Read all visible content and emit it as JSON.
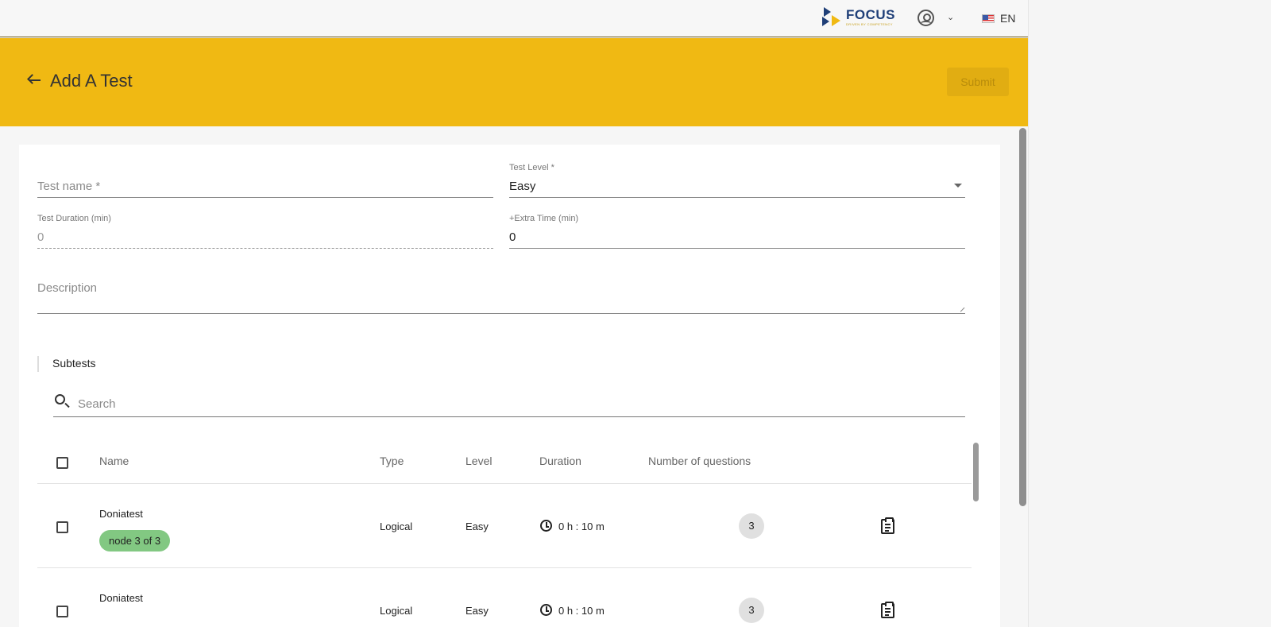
{
  "topbar": {
    "brand_name": "FOCUS",
    "brand_tagline": "DRIVEN BY COMPETENCY",
    "language": "EN"
  },
  "header": {
    "title": "Add A Test",
    "submit_label": "Submit"
  },
  "form": {
    "test_name_placeholder": "Test name *",
    "test_level_label": "Test Level *",
    "test_level_value": "Easy",
    "duration_label": "Test Duration (min)",
    "duration_value": "0",
    "extra_time_label": "+Extra Time (min)",
    "extra_time_value": "0",
    "description_placeholder": "Description"
  },
  "subtests": {
    "label": "Subtests",
    "search_placeholder": "Search",
    "columns": {
      "name": "Name",
      "type": "Type",
      "level": "Level",
      "duration": "Duration",
      "questions": "Number of questions"
    },
    "rows": [
      {
        "name": "Doniatest",
        "tag": "node 3 of 3",
        "type": "Logical",
        "level": "Easy",
        "duration": "0 h : 10 m",
        "questions": "3"
      },
      {
        "name": "Doniatest",
        "tag": "",
        "type": "Logical",
        "level": "Easy",
        "duration": "0 h : 10 m",
        "questions": "3"
      }
    ]
  },
  "colors": {
    "accent_yellow": "#f0b913",
    "brand_blue": "#1f3f78",
    "tag_green": "#82c882"
  }
}
